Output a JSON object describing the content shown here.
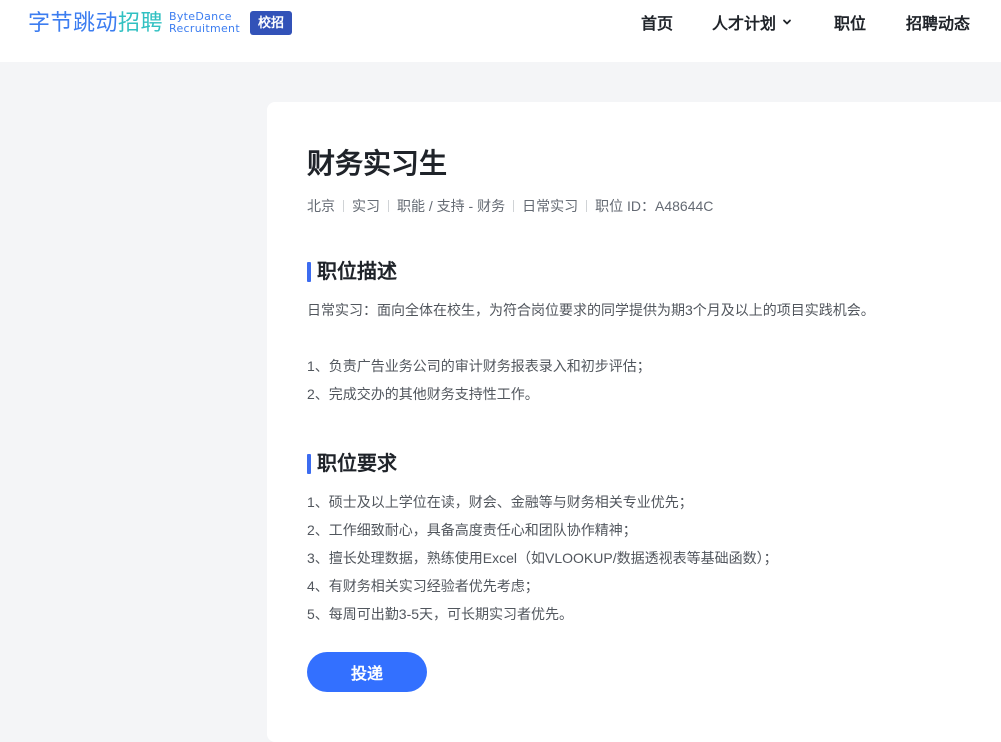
{
  "header": {
    "logo_cn_main": "字节跳动",
    "logo_cn_highlight": "招聘",
    "logo_en_line1": "ByteDance",
    "logo_en_line2": "Recruitment",
    "campus_badge": "校招",
    "nav": {
      "home": "首页",
      "talent_programs": "人才计划",
      "jobs": "职位",
      "news": "招聘动态"
    }
  },
  "job": {
    "title": "财务实习生",
    "meta": {
      "city": "北京",
      "type": "实习",
      "category": "职能 / 支持 - 财务",
      "program": "日常实习",
      "id_label": "职位 ID：A48644C"
    },
    "description": {
      "heading": "职位描述",
      "intro": "日常实习：面向全体在校生，为符合岗位要求的同学提供为期3个月及以上的项目实践机会。",
      "items": [
        "1、负责广告业务公司的审计财务报表录入和初步评估；",
        "2、完成交办的其他财务支持性工作。"
      ]
    },
    "requirements": {
      "heading": "职位要求",
      "items": [
        "1、硕士及以上学位在读，财会、金融等与财务相关专业优先；",
        "2、工作细致耐心，具备高度责任心和团队协作精神；",
        "3、擅长处理数据，熟练使用Excel（如VLOOKUP/数据透视表等基础函数）；",
        "4、有财务相关实习经验者优先考虑；",
        "5、每周可出勤3-5天，可长期实习者优先。"
      ]
    },
    "apply_label": "投递"
  },
  "colors": {
    "brand_blue": "#3c7df0",
    "brand_teal": "#31c0c2",
    "badge_bg": "#3252b8",
    "button_bg": "#3370ff",
    "section_bar": "#3c6cf0",
    "page_bg": "#f4f5f7"
  },
  "icons": {
    "talent_dropdown": "chevron-down-icon"
  }
}
